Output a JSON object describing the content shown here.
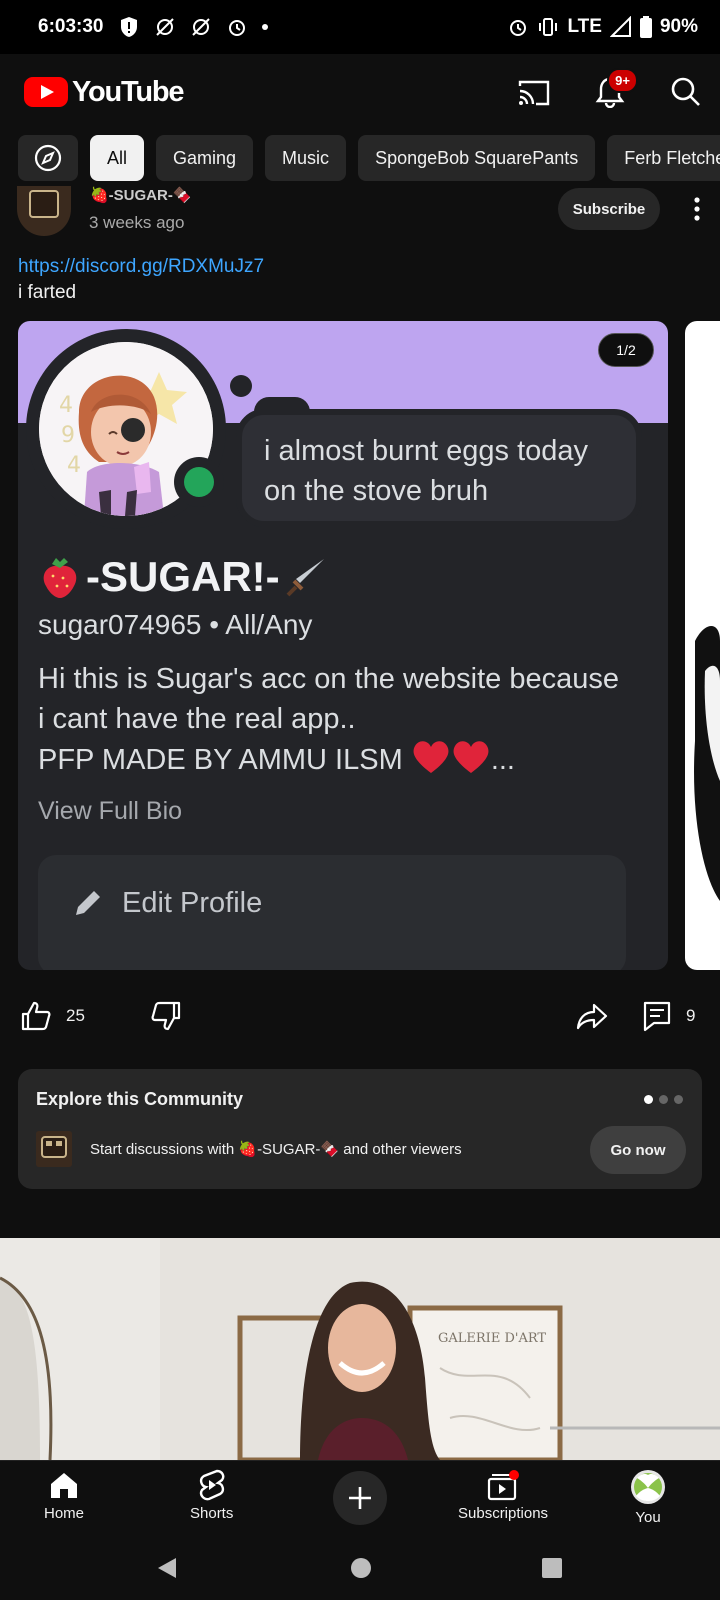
{
  "status_bar": {
    "time": "6:03:30",
    "network": "LTE",
    "battery": "90%"
  },
  "app": {
    "name": "YouTube",
    "notification_count": "9+"
  },
  "chips": [
    {
      "label": "All",
      "active": true
    },
    {
      "label": "Gaming"
    },
    {
      "label": "Music"
    },
    {
      "label": "SpongeBob SquarePants"
    },
    {
      "label": "Ferb Fletcher"
    }
  ],
  "post": {
    "author": "🍓-SUGAR-🍫",
    "time": "3 weeks ago",
    "subscribe_label": "Subscribe",
    "link": "https://discord.gg/RDXMuJz7",
    "text": "i farted",
    "image_counter": "1/2",
    "image": {
      "status_text": "i almost burnt eggs today on the stove bruh",
      "display_name": "-SUGAR!-",
      "username": "sugar074965 • All/Any",
      "bio_line1": "Hi this is Sugar's acc on the website because",
      "bio_line2": "i cant have the real app..",
      "bio_line3": "PFP MADE BY AMMU ILSM",
      "bio_ellipsis": "...",
      "view_bio": "View Full Bio",
      "edit_profile": "Edit Profile"
    },
    "likes": "25",
    "comments": "9"
  },
  "community": {
    "title": "Explore this Community",
    "text": "Start discussions with 🍓-SUGAR-🍫 and other viewers",
    "button": "Go now"
  },
  "video": {
    "sign_text": "GALERIE D'ART"
  },
  "bottom_nav": {
    "home": "Home",
    "shorts": "Shorts",
    "subscriptions": "Subscriptions",
    "you": "You"
  },
  "colors": {
    "brand": "#ff0000",
    "link": "#3ea6ff",
    "background": "#0f0f0f",
    "discord_banner": "#bea5f0",
    "online": "#23a55a"
  }
}
